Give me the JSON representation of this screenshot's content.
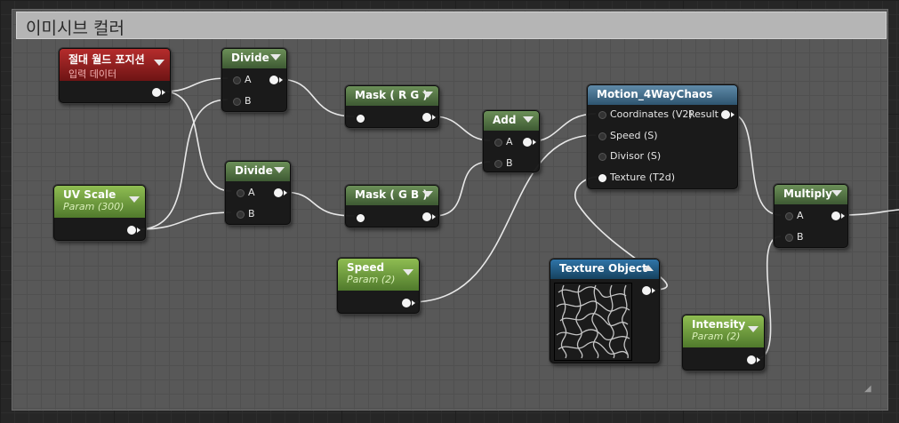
{
  "comment": {
    "title": "이미시브 컬러"
  },
  "nodes": {
    "world_pos": {
      "title": "절대 월드 포지션",
      "subtitle": "입력 데이터"
    },
    "divide1": {
      "title": "Divide",
      "pin_a": "A",
      "pin_b": "B"
    },
    "divide2": {
      "title": "Divide",
      "pin_a": "A",
      "pin_b": "B"
    },
    "uv_scale": {
      "title": "UV Scale",
      "subtitle": "Param (300)"
    },
    "mask_rg": {
      "title": "Mask ( R G )"
    },
    "mask_gb": {
      "title": "Mask ( G B )"
    },
    "add": {
      "title": "Add",
      "pin_a": "A",
      "pin_b": "B"
    },
    "speed": {
      "title": "Speed",
      "subtitle": "Param (2)"
    },
    "motion": {
      "title": "Motion_4WayChaos",
      "pins": [
        "Coordinates (V2)",
        "Speed (S)",
        "Divisor (S)",
        "Texture (T2d)"
      ],
      "output": "Result"
    },
    "texture_object": {
      "title": "Texture Object"
    },
    "intensity": {
      "title": "Intensity",
      "subtitle": "Param (2)"
    },
    "multiply": {
      "title": "Multiply",
      "pin_a": "A",
      "pin_b": "B"
    }
  },
  "colors": {
    "param_header": "#4f7340",
    "input_header": "#9b2121",
    "function_header": "#3f6885",
    "wire": "#e8e8e8"
  }
}
